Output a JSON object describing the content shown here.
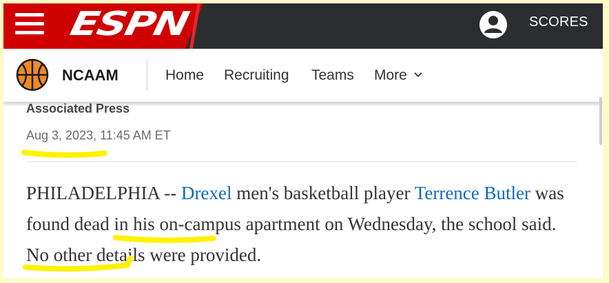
{
  "header": {
    "logo_text": "ESPN",
    "scores_label": "SCORES",
    "brand_color": "#d00000",
    "bar_color": "#2c2d2f"
  },
  "subnav": {
    "league": "NCAAM",
    "links": {
      "home": "Home",
      "recruiting": "Recruiting",
      "teams": "Teams",
      "more": "More"
    }
  },
  "article": {
    "byline": "Associated Press",
    "timestamp": "Aug 3, 2023, 11:45 AM ET",
    "body": {
      "part1": "PHILADELPHIA -- ",
      "link1": "Drexel",
      "part2": " men's basketball player ",
      "link2": "Terrence Butler",
      "part3": " was found dead in his on-campus apartment on Wednesday, the school said. No other details were provided."
    },
    "link_color": "#0e6bbd"
  },
  "annotations": {
    "highlight_color": "#fff200"
  }
}
